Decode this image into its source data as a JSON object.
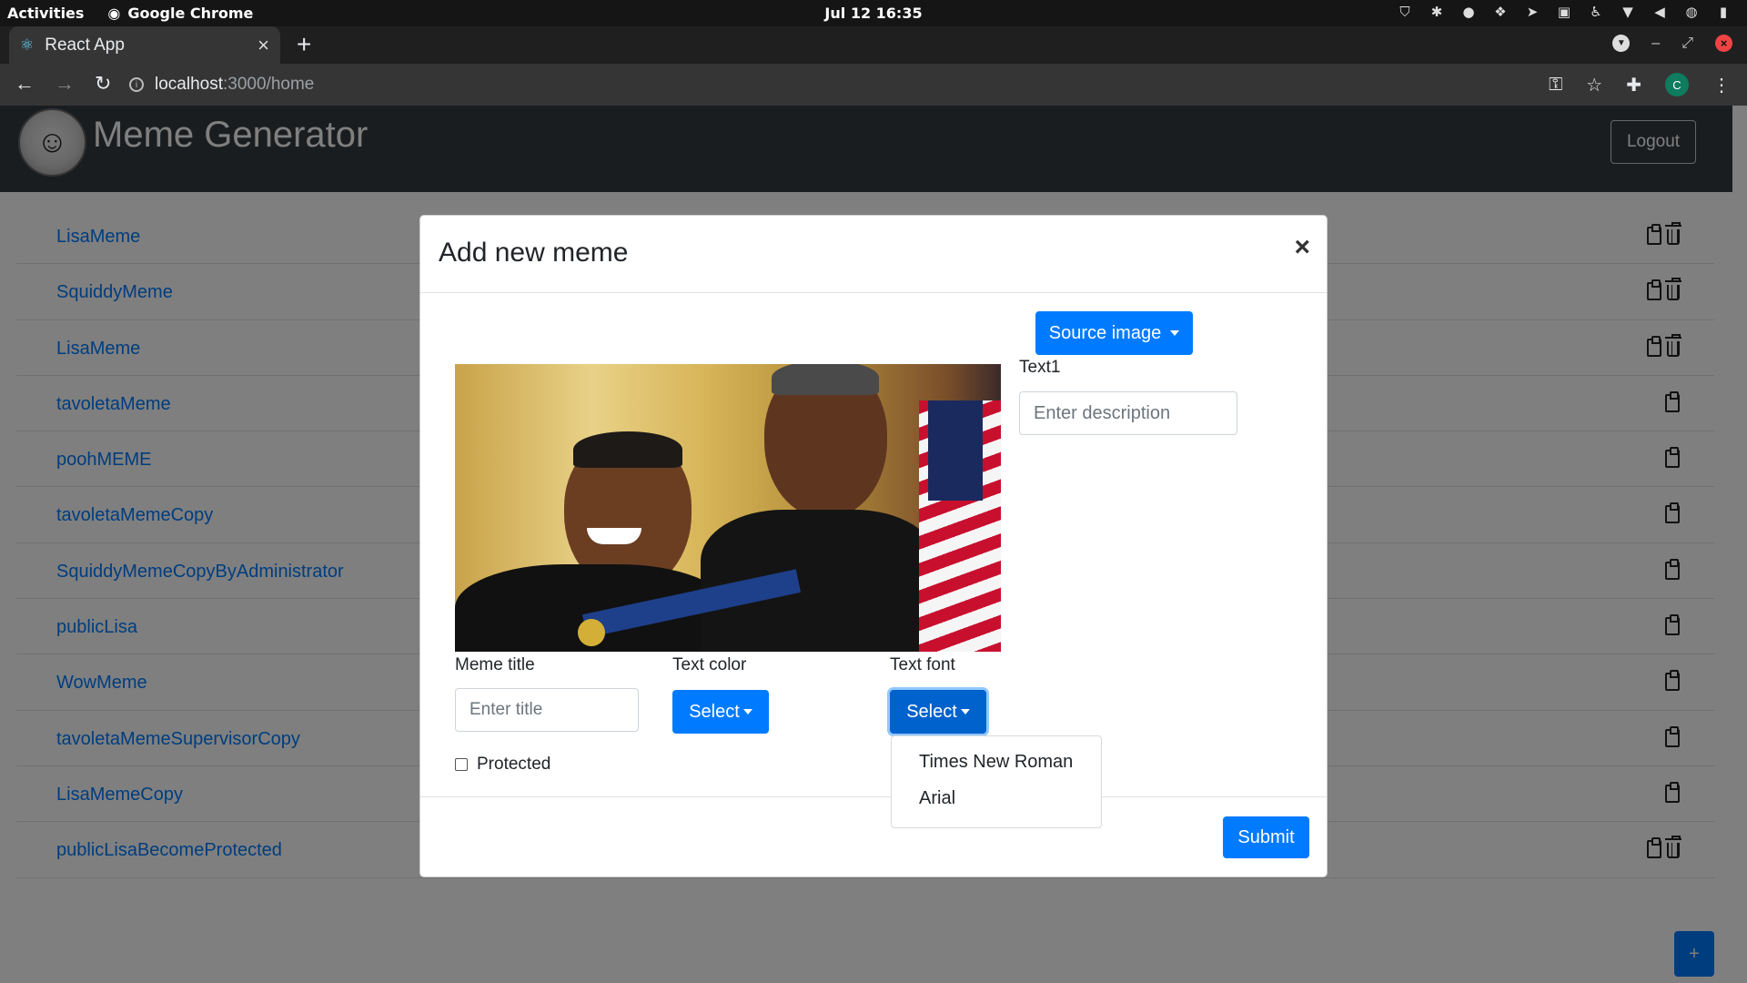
{
  "system_bar": {
    "activities": "Activities",
    "app_name": "Google Chrome",
    "clock": "Jul 12  16:35"
  },
  "browser": {
    "tab_title": "React App",
    "url_host": "localhost",
    "url_path": ":3000/home",
    "profile_initial": "C"
  },
  "navbar": {
    "brand": "Meme Generator",
    "logout_label": "Logout"
  },
  "memes": [
    {
      "name": "LisaMeme",
      "deletable": true
    },
    {
      "name": "SquiddyMeme",
      "deletable": true
    },
    {
      "name": "LisaMeme",
      "deletable": true
    },
    {
      "name": "tavoletaMeme",
      "deletable": false
    },
    {
      "name": "poohMEME",
      "deletable": false
    },
    {
      "name": "tavoletaMemeCopy",
      "deletable": false
    },
    {
      "name": "SquiddyMemeCopyByAdministrator",
      "deletable": false
    },
    {
      "name": "publicLisa",
      "deletable": false
    },
    {
      "name": "WowMeme",
      "deletable": false
    },
    {
      "name": "tavoletaMemeSupervisorCopy",
      "deletable": false
    },
    {
      "name": "LisaMemeCopy",
      "deletable": false
    },
    {
      "name": "publicLisaBecomeProtected",
      "deletable": true
    }
  ],
  "fab_label": "+",
  "modal": {
    "title": "Add new meme",
    "close_glyph": "×",
    "source_image_label": "Source image",
    "text1_label": "Text1",
    "text1_placeholder": "Enter description",
    "meme_title_label": "Meme title",
    "meme_title_placeholder": "Enter title",
    "text_color_label": "Text color",
    "text_color_select": "Select",
    "text_font_label": "Text font",
    "text_font_select": "Select",
    "protected_label": "Protected",
    "protected_checked": false,
    "submit_label": "Submit",
    "font_options": [
      "Times New Roman",
      "Arial"
    ]
  },
  "colors": {
    "primary": "#007bff",
    "navbar_bg": "#343a40",
    "link": "#007bff"
  }
}
